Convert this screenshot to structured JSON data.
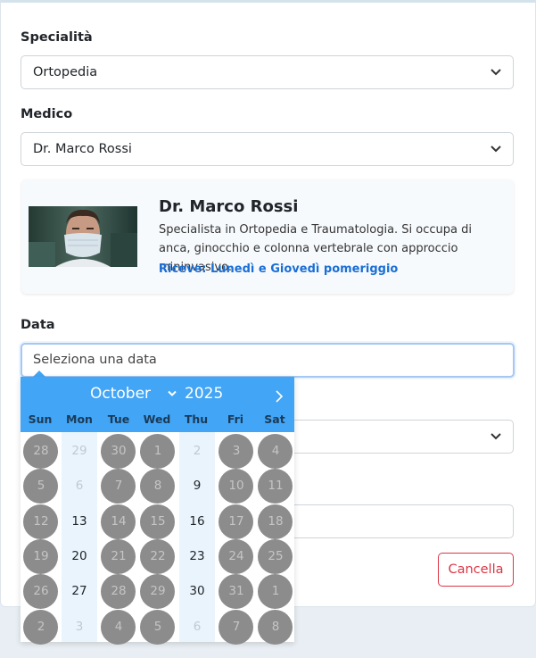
{
  "form": {
    "specialty_label": "Specialità",
    "specialty_value": "Ortopedia",
    "doctor_label": "Medico",
    "doctor_value": "Dr. Marco Rossi",
    "date_label": "Data",
    "date_placeholder": "Seleziona una data",
    "cancel_label": "Cancella"
  },
  "doctor_card": {
    "name": "Dr. Marco Rossi",
    "description": "Specialista in Ortopedia e Traumatologia. Si occupa di anca, ginocchio e colonna vertebrale con approccio mininvasivo.",
    "hours": "Riceve: Lunedì e Giovedì pomeriggio"
  },
  "calendar": {
    "month": "October",
    "year": "2025",
    "weekdays": [
      "Sun",
      "Mon",
      "Tue",
      "Wed",
      "Thu",
      "Fri",
      "Sat"
    ],
    "weeks": [
      [
        [
          "28",
          "disabled"
        ],
        [
          "29",
          "faded"
        ],
        [
          "30",
          "disabled"
        ],
        [
          "1",
          "disabled"
        ],
        [
          "2",
          "faded"
        ],
        [
          "3",
          "disabled"
        ],
        [
          "4",
          "disabled"
        ]
      ],
      [
        [
          "5",
          "disabled"
        ],
        [
          "6",
          "faded"
        ],
        [
          "7",
          "disabled"
        ],
        [
          "8",
          "disabled"
        ],
        [
          "9",
          "available"
        ],
        [
          "10",
          "disabled"
        ],
        [
          "11",
          "disabled"
        ]
      ],
      [
        [
          "12",
          "disabled"
        ],
        [
          "13",
          "available"
        ],
        [
          "14",
          "disabled"
        ],
        [
          "15",
          "disabled"
        ],
        [
          "16",
          "available"
        ],
        [
          "17",
          "disabled"
        ],
        [
          "18",
          "disabled"
        ]
      ],
      [
        [
          "19",
          "disabled"
        ],
        [
          "20",
          "available"
        ],
        [
          "21",
          "disabled"
        ],
        [
          "22",
          "disabled"
        ],
        [
          "23",
          "available"
        ],
        [
          "24",
          "disabled"
        ],
        [
          "25",
          "disabled"
        ]
      ],
      [
        [
          "26",
          "disabled"
        ],
        [
          "27",
          "available"
        ],
        [
          "28",
          "disabled"
        ],
        [
          "29",
          "disabled"
        ],
        [
          "30",
          "available"
        ],
        [
          "31",
          "disabled"
        ],
        [
          "1",
          "disabled"
        ]
      ],
      [
        [
          "2",
          "disabled"
        ],
        [
          "3",
          "faded"
        ],
        [
          "4",
          "disabled"
        ],
        [
          "5",
          "disabled"
        ],
        [
          "6",
          "faded"
        ],
        [
          "7",
          "disabled"
        ],
        [
          "8",
          "disabled"
        ]
      ]
    ]
  },
  "colors": {
    "accent": "#42a5f5",
    "danger": "#dc3545",
    "link": "#1a6fd6"
  }
}
